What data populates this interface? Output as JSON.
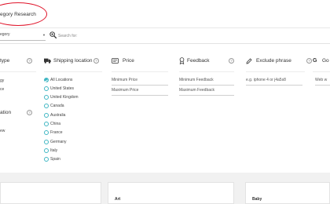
{
  "header": {
    "title": "egory Research"
  },
  "search": {
    "category_value": "egory",
    "placeholder": "Search for:"
  },
  "filters": {
    "type": {
      "label": "type",
      "options": [
        "gy",
        "ce"
      ]
    },
    "location": {
      "label": "ation",
      "options": [
        "ew"
      ]
    },
    "shipping": {
      "label": "Shipping location",
      "options": [
        "All Locations",
        "United States",
        "United Kingdom",
        "Canada",
        "Australia",
        "China",
        "France",
        "Germany",
        "Italy",
        "Spain"
      ],
      "selected": "All Locations"
    },
    "price": {
      "label": "Price",
      "min_placeholder": "Minimum Price",
      "max_placeholder": "Maximum Price"
    },
    "feedback": {
      "label": "Feedback",
      "min_placeholder": "Minimum Feedback",
      "max_placeholder": "Maximum Feedback"
    },
    "exclude": {
      "label": "Exclude phrase",
      "placeholder": "e.g. iphone 4 or j4a5s8"
    },
    "google": {
      "label": "Go",
      "placeholder": "Web w"
    }
  },
  "cards": [
    {
      "title": ""
    },
    {
      "title": "Art"
    },
    {
      "title": "Baby"
    }
  ],
  "colors": {
    "accent": "#3fb6c3",
    "annotation": "#e0152b",
    "background": "#f1f1f1"
  },
  "icons": {
    "shipping": "truck-icon",
    "price": "price-tag-icon",
    "feedback": "award-icon",
    "exclude": "pen-icon",
    "google": "google-icon",
    "help": "help-circle-icon",
    "search": "search-plus-icon"
  }
}
